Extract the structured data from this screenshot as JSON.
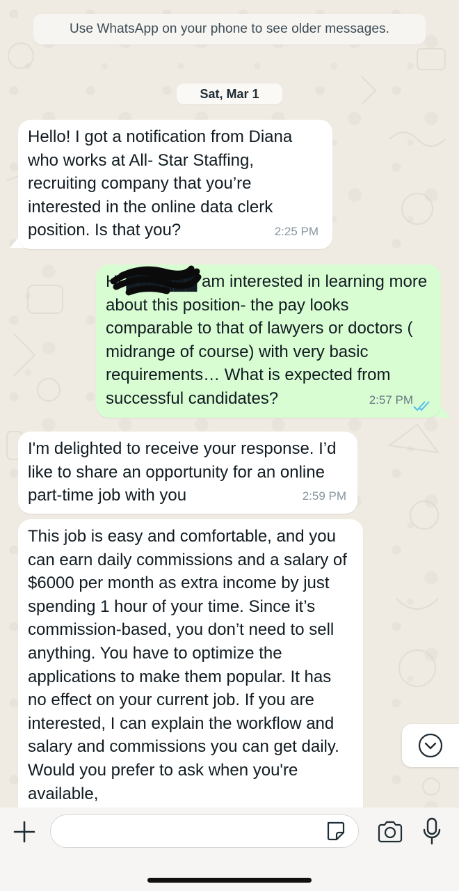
{
  "chat": {
    "system_notice": "Use WhatsApp on your phone to see older messages.",
    "date_chip": "Sat, Mar 1",
    "messages": [
      {
        "direction": "incoming",
        "text": "Hello! I got a notification from Diana who works at All- Star Staffing, recruiting company that you’re interested in the online data clerk position. Is that you?",
        "time": "2:25 PM"
      },
      {
        "direction": "outgoing",
        "text": "Hi ██████ am interested in learning more about this position- the pay looks comparable to that of lawyers or doctors ( midrange of course) with very basic requirements… What is expected from successful candidates?",
        "time": "2:57 PM",
        "status": "read"
      },
      {
        "direction": "incoming",
        "text": "I'm delighted to receive your response. I’d like to share an opportunity for an online part-time job with you",
        "time": "2:59 PM"
      },
      {
        "direction": "incoming",
        "text": "This job is easy and comfortable, and you can earn daily commissions and a salary of $6000 per month as extra income by just spending 1 hour of your time. Since it’s commission-based, you don’t need to sell anything. You have to optimize the applications to make them popular. It has no effect on your current job. If you are interested, I can explain the workflow and salary and commissions you can get daily. Would you prefer to ask when you're available,",
        "time": ""
      }
    ]
  },
  "composer": {
    "input_value": "",
    "icons": [
      "plus-icon",
      "sticker-icon",
      "camera-icon",
      "microphone-icon"
    ]
  },
  "colors": {
    "wallpaper": "#efeae2",
    "incoming_bubble": "#ffffff",
    "outgoing_bubble": "#d9fdd3",
    "read_ticks": "#53bdeb",
    "timestamp": "#8696a0"
  }
}
